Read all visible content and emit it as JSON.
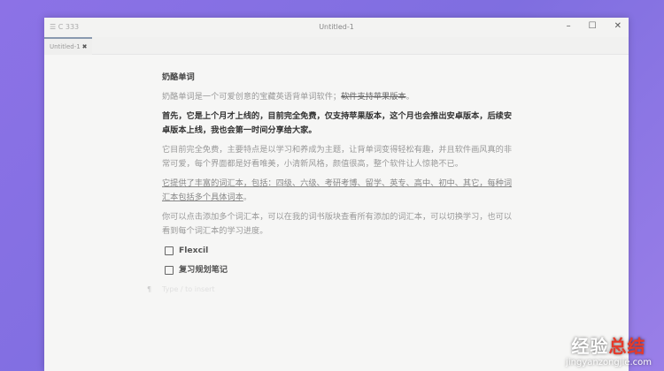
{
  "window": {
    "app_label": "C 333",
    "title": "Untitled-1",
    "minimize": "–",
    "maximize": "☐",
    "close": "✕"
  },
  "tab": {
    "label": "Untitled-1",
    "close": "✖"
  },
  "doc": {
    "heading": "奶酪单词",
    "p1": "奶酪单词是一个可爱创意的宝藏英语背单词软件；",
    "p1_strike": "软件支持苹果版本",
    "p1_end": "。",
    "p2": "首先，它是上个月才上线的，目前完全免费，仅支持苹果版本，这个月也会推出安卓版本，后续安卓版本上线，我也会第一时间分享给大家。",
    "p3": "它目前完全免费，主要特点是以学习和养成为主题，让背单词变得轻松有趣，并且软件画风真的非常可爱，每个界面都是好看唯美，小清新风格，颜值很高，整个软件让人惊艳不已。",
    "p4": "它提供了丰富的词汇本，包括：四级、六级、考研考博、留学、英专、高中、初中、其它，每种词汇本包括多个具体词本",
    "p4_end": "。",
    "p5": "你可以点击添加多个词汇本，可以在我的词书版块查看所有添加的词汇本，可以切换学习，也可以看到每个词汇本的学习进度。",
    "tasks": [
      "Flexcil",
      "复习规划笔记"
    ],
    "placeholder_mark": "¶",
    "placeholder": "Type / to insert"
  },
  "watermark": {
    "line1a": "经验",
    "line1b": "总结",
    "line2": "jingyanzongjie.com"
  }
}
